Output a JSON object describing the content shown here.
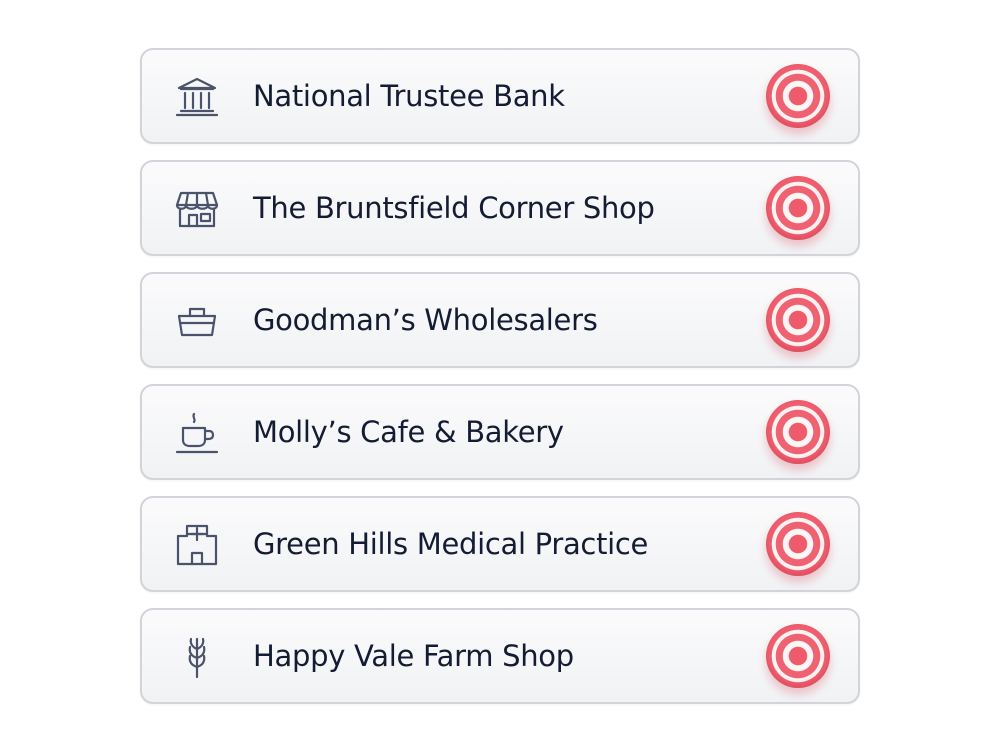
{
  "items": [
    {
      "label": "National Trustee Bank",
      "icon": "bank-icon"
    },
    {
      "label": "The Bruntsfield Corner Shop",
      "icon": "storefront-icon"
    },
    {
      "label": "Goodman’s Wholesalers",
      "icon": "basket-icon"
    },
    {
      "label": "Molly’s Cafe & Bakery",
      "icon": "coffee-cup-icon"
    },
    {
      "label": "Green Hills Medical Practice",
      "icon": "hospital-icon"
    },
    {
      "label": "Happy Vale Farm Shop",
      "icon": "wheat-icon"
    }
  ],
  "colors": {
    "icon": "#4a536b",
    "text": "#141c34",
    "target": "#ee5b6a",
    "border": "#d3d4d9"
  }
}
